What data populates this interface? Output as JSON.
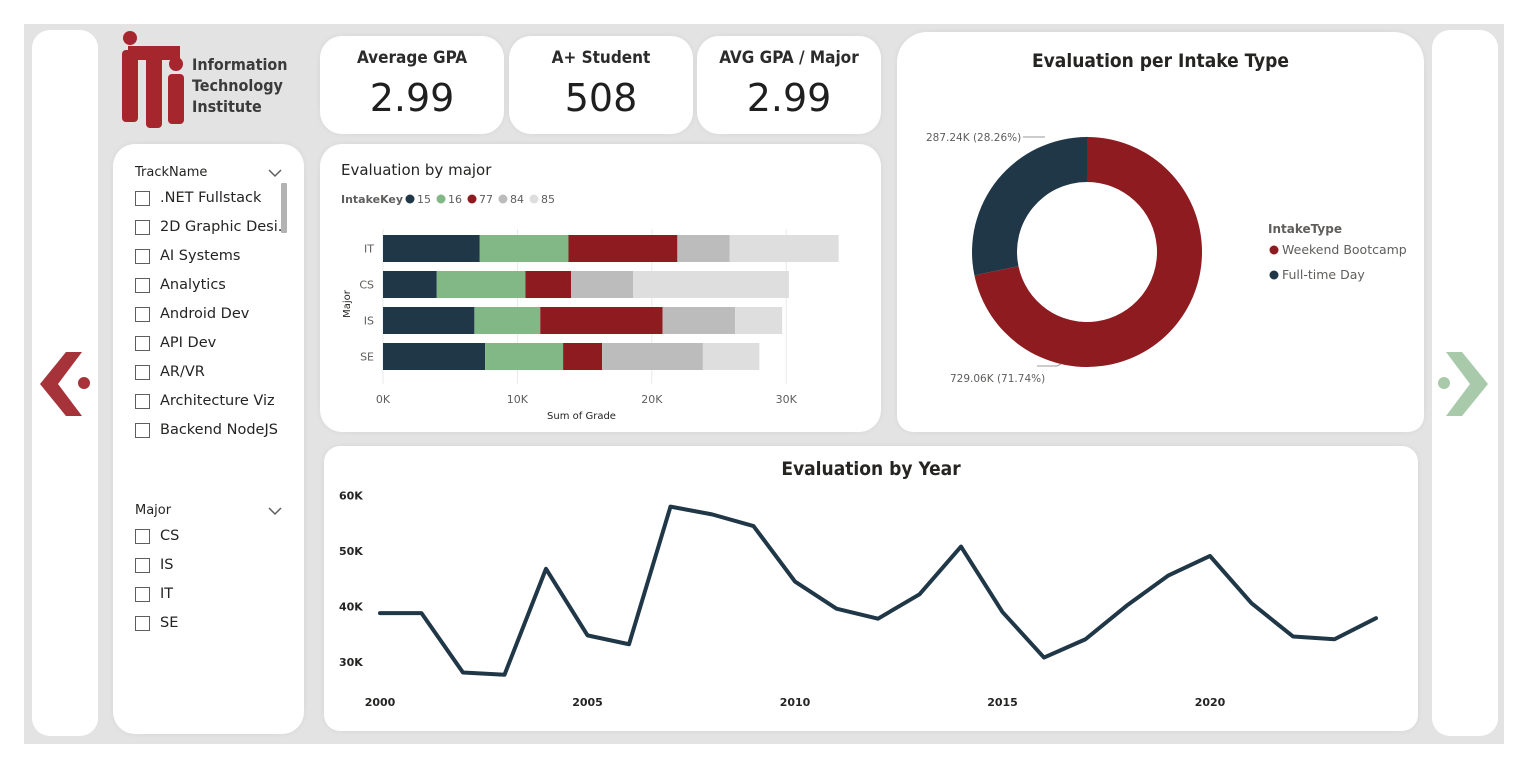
{
  "logo": {
    "text": [
      "Information",
      "Technology",
      "Institute"
    ]
  },
  "nav": {
    "prev": "arrow-left-icon",
    "next": "arrow-right-icon"
  },
  "kpis": [
    {
      "title": "Average GPA",
      "value": "2.99"
    },
    {
      "title": "A+ Student",
      "value": "508"
    },
    {
      "title": "AVG GPA / Major",
      "value": "2.99"
    }
  ],
  "slicers": {
    "track": {
      "title": "TrackName",
      "items": [
        ".NET Fullstack",
        "2D Graphic Desi...",
        "AI Systems",
        "Analytics",
        "Android Dev",
        "API Dev",
        "AR/VR",
        "Architecture Viz",
        "Backend NodeJS"
      ]
    },
    "major": {
      "title": "Major",
      "items": [
        "CS",
        "IS",
        "IT",
        "SE"
      ]
    }
  },
  "colors": {
    "navy": "#203747",
    "green": "#82b786",
    "red": "#8d1b20",
    "gray": "#bcbcbc",
    "lightgray": "#dedede",
    "arrow_prev": "#a6333a",
    "arrow_next": "#a9c9ab"
  },
  "chart_data": [
    {
      "type": "bar",
      "orientation": "horizontal",
      "stacked": true,
      "title": "Evaluation by major",
      "legend_title": "IntakeKey",
      "categories": [
        "IT",
        "CS",
        "IS",
        "SE"
      ],
      "series": [
        {
          "name": "15",
          "values": [
            7200,
            4000,
            6800,
            7600
          ]
        },
        {
          "name": "16",
          "values": [
            6600,
            6600,
            4900,
            5800
          ]
        },
        {
          "name": "77",
          "values": [
            8100,
            3400,
            9100,
            2900
          ]
        },
        {
          "name": "84",
          "values": [
            3900,
            4600,
            5400,
            7500
          ]
        },
        {
          "name": "85",
          "values": [
            8100,
            11600,
            3500,
            4200
          ]
        }
      ],
      "xlabel": "Sum of Grade",
      "ylabel": "Major",
      "xlim": [
        0,
        34000
      ],
      "xticks": [
        "0K",
        "10K",
        "20K",
        "30K"
      ],
      "xtick_values": [
        0,
        10000,
        20000,
        30000
      ],
      "grid": true
    },
    {
      "type": "pie",
      "donut": true,
      "title": "Evaluation per Intake Type",
      "legend_title": "IntakeType",
      "legend_position": "right",
      "labels": [
        "Weekend Bootcamp",
        "Full-time Day"
      ],
      "values": [
        729060,
        287240
      ],
      "data_labels": [
        "729.06K (71.74%)",
        "287.24K (28.26%)"
      ]
    },
    {
      "type": "line",
      "title": "Evaluation by Year",
      "x": [
        2000,
        2001,
        2002,
        2003,
        2004,
        2005,
        2006,
        2007,
        2008,
        2009,
        2010,
        2011,
        2012,
        2013,
        2014,
        2015,
        2016,
        2017,
        2018,
        2019,
        2020,
        2021,
        2022,
        2023,
        2024
      ],
      "values": [
        38800,
        38800,
        28100,
        27700,
        46800,
        34800,
        33200,
        58000,
        56600,
        54500,
        44500,
        39600,
        37800,
        42200,
        50800,
        39000,
        30800,
        34100,
        40200,
        45600,
        49100,
        40600,
        34600,
        34100,
        37900
      ],
      "ylim": [
        25000,
        62000
      ],
      "yticks": [
        "30K",
        "40K",
        "50K",
        "60K"
      ],
      "ytick_values": [
        30000,
        40000,
        50000,
        60000
      ],
      "xticks": [
        "2000",
        "2005",
        "2010",
        "2015",
        "2020"
      ],
      "xtick_values": [
        2000,
        2005,
        2010,
        2015,
        2020
      ],
      "grid": false
    }
  ]
}
